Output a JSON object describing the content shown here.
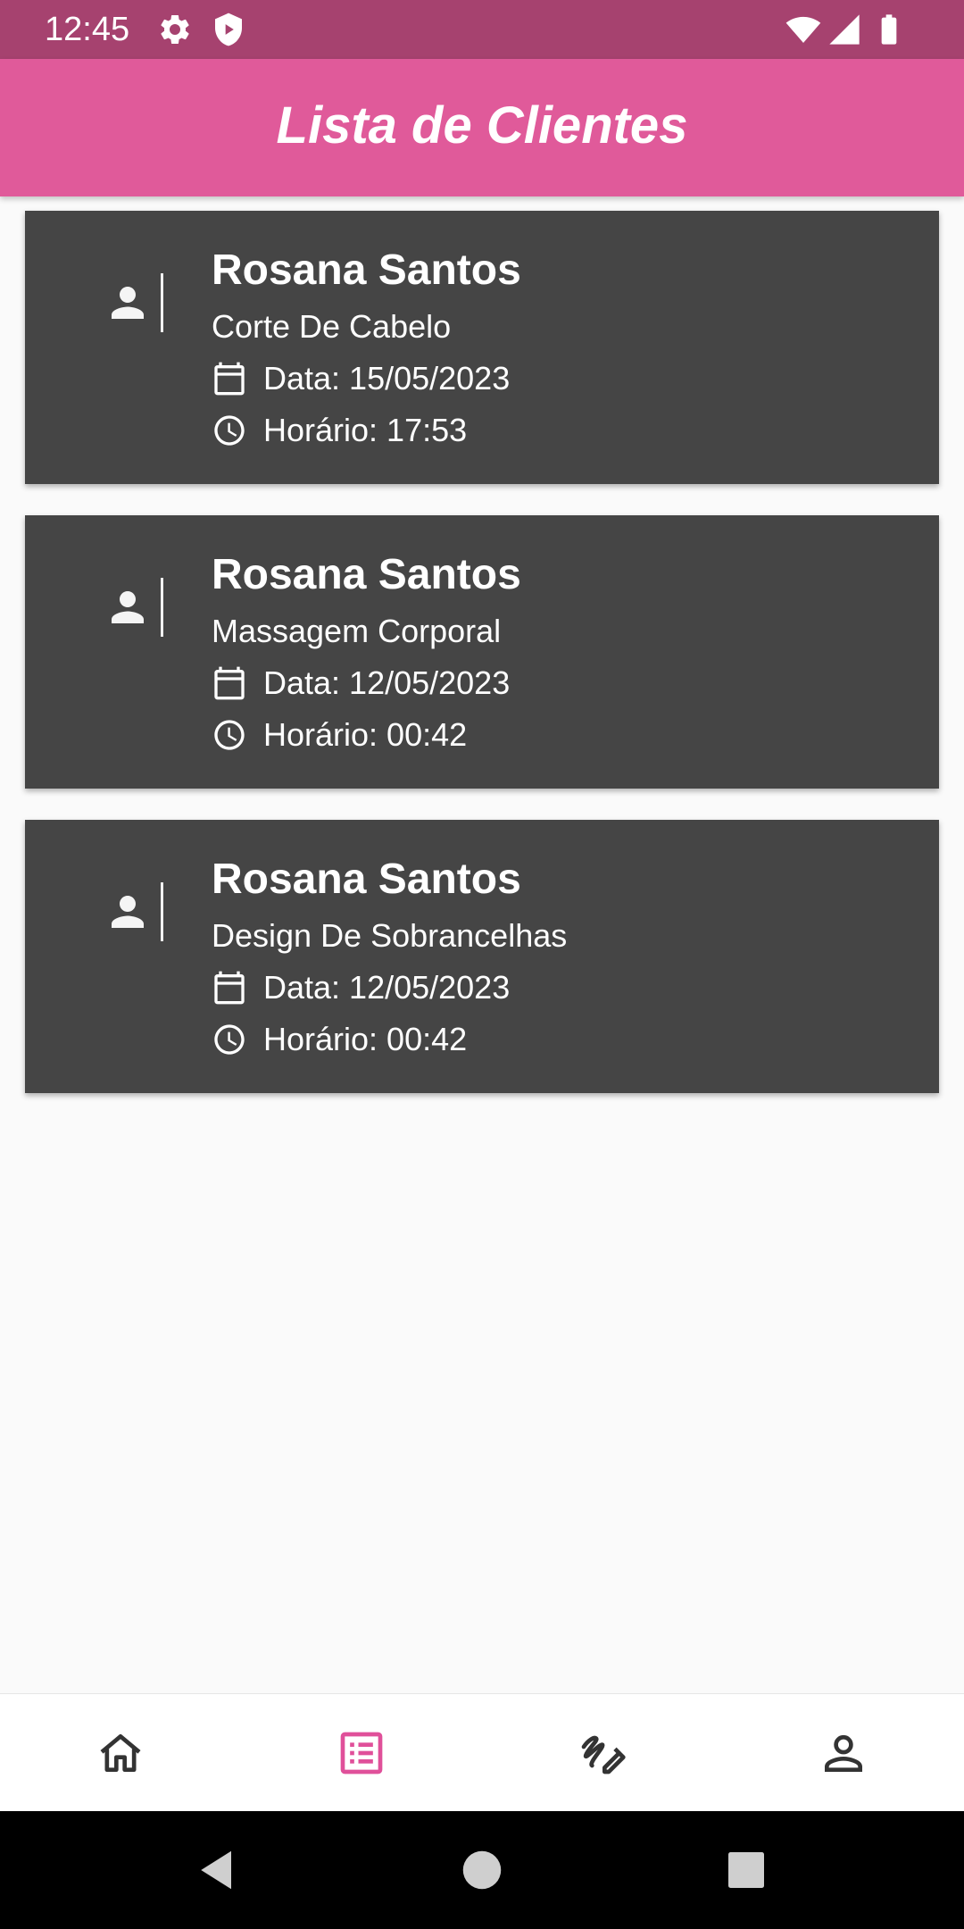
{
  "status_bar": {
    "time": "12:45",
    "icons": [
      "gear-icon",
      "shield-icon",
      "wifi-icon",
      "signal-icon",
      "battery-icon"
    ]
  },
  "app_bar": {
    "title": "Lista de Clientes"
  },
  "clients": [
    {
      "name": "Rosana Santos",
      "service": "Corte De Cabelo",
      "date": "Data: 15/05/2023",
      "time": "Horário: 17:53"
    },
    {
      "name": "Rosana Santos",
      "service": "Massagem Corporal",
      "date": "Data: 12/05/2023",
      "time": "Horário: 00:42"
    },
    {
      "name": "Rosana Santos",
      "service": "Design De Sobrancelhas",
      "date": "Data: 12/05/2023",
      "time": "Horário: 00:42"
    }
  ],
  "bottom_nav": {
    "items": [
      "home-icon",
      "list-icon",
      "draw-icon",
      "person-icon"
    ],
    "active": "list-icon"
  },
  "system_nav": {
    "buttons": [
      "back-icon",
      "home-circle-icon",
      "recents-icon"
    ]
  },
  "colors": {
    "status_bar": "#a6426f",
    "app_bar": "#e05a9a",
    "card": "#454545",
    "accent": "#e0509a",
    "nav_icon": "#333333",
    "background": "#fafafa"
  }
}
